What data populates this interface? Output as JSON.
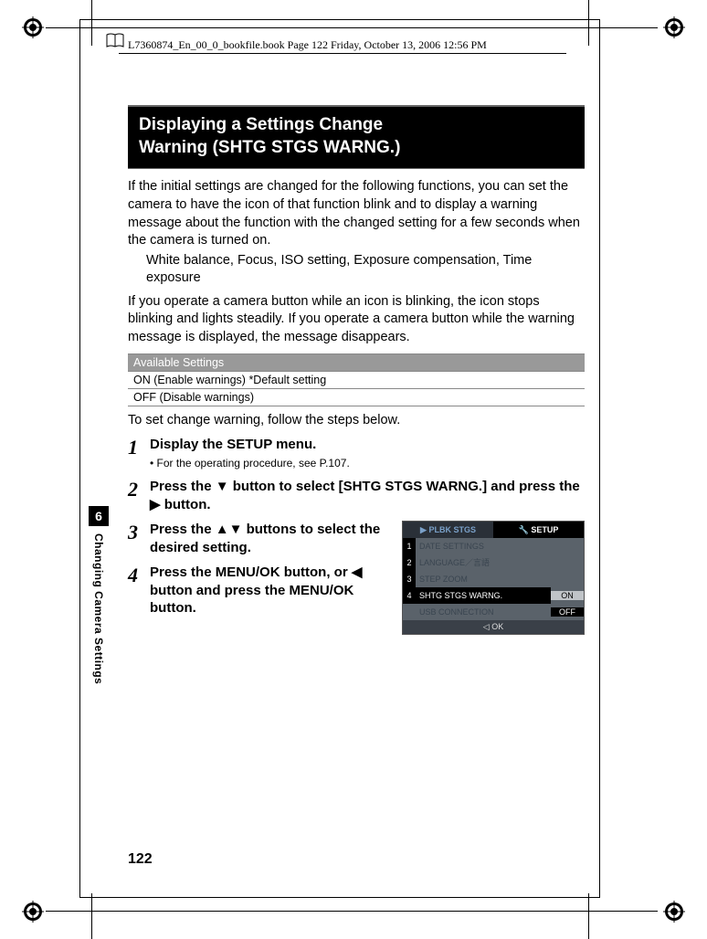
{
  "header": "L7360874_En_00_0_bookfile.book  Page 122  Friday, October 13, 2006  12:56 PM",
  "title_line1": "Displaying a Settings Change",
  "title_line2": "Warning (SHTG STGS WARNG.)",
  "para1": "If the initial settings are changed for the following functions, you can set the camera to have the icon of that function blink and to display a warning message about the function with the changed setting for a few seconds when the camera is turned on.",
  "functions_line": "White balance, Focus, ISO setting, Exposure compensation, Time exposure",
  "para2": "If you operate a camera button while an icon is blinking, the icon stops blinking and lights steadily. If you operate a camera button while the warning message is displayed, the message disappears.",
  "table": {
    "header": "Available Settings",
    "rows": [
      "ON (Enable warnings) *Default setting",
      "OFF (Disable warnings)"
    ]
  },
  "lead": "To set change warning, follow the steps below.",
  "steps": [
    {
      "n": "1",
      "title": "Display the SETUP menu.",
      "sub": "•  For the operating procedure, see P.107."
    },
    {
      "n": "2",
      "title_pre": "Press the ",
      "arrow1": "▼",
      "title_mid": " button to select [SHTG STGS WARNG.] and press the ",
      "arrow2": "▶",
      "title_post": " button."
    },
    {
      "n": "3",
      "title_pre": "Press the ",
      "arrows": "▲▼",
      "title_post": " buttons to select the desired setting."
    },
    {
      "n": "4",
      "title_pre": "Press the MENU/OK button, or ",
      "arrow1": "◀",
      "title_post": " button and press the MENU/OK button."
    }
  ],
  "sidebar": {
    "chapter": "6",
    "label": "Changing Camera Settings"
  },
  "pagenum": "122",
  "cam": {
    "tab_left": "PLBK STGS",
    "tab_right": "SETUP",
    "rows": [
      {
        "idx": "1",
        "label": "DATE SETTINGS"
      },
      {
        "idx": "2",
        "label": "LANGUAGE／言語"
      },
      {
        "idx": "3",
        "label": "STEP ZOOM"
      },
      {
        "idx": "4",
        "label": "SHTG STGS WARNG.",
        "val": "ON",
        "sel": true
      },
      {
        "idx": "",
        "label": "USB CONNECTION",
        "val": "OFF"
      }
    ],
    "footer": "◁ OK"
  }
}
